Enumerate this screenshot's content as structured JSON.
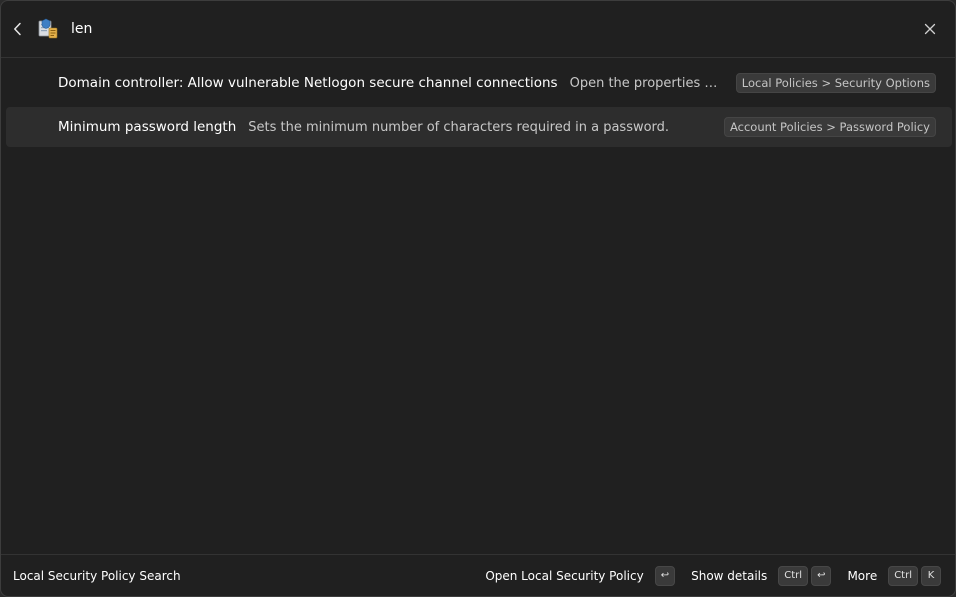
{
  "search": {
    "query": "len"
  },
  "results": [
    {
      "title": "Domain controller: Allow vulnerable Netlogon secure channel connections",
      "description": "Open the properties of this p...",
      "tag": "Local Policies > Security Options"
    },
    {
      "title": "Minimum password length",
      "description": "Sets the minimum number of characters required in a password.",
      "tag": "Account Policies > Password Policy"
    }
  ],
  "footer": {
    "title": "Local Security Policy Search",
    "primary_action": "Open Local Security Policy",
    "primary_key": "↩",
    "details_action": "Show details",
    "details_key_1": "Ctrl",
    "details_key_2": "↩",
    "more_action": "More",
    "more_key_1": "Ctrl",
    "more_key_2": "K"
  },
  "icons": {
    "back": "chevron-left-icon",
    "app": "security-policy-icon",
    "close": "close-icon"
  },
  "colors": {
    "background": "#202020",
    "selected_row": "#2d2d2d",
    "tag_background": "#3a3a3a"
  }
}
